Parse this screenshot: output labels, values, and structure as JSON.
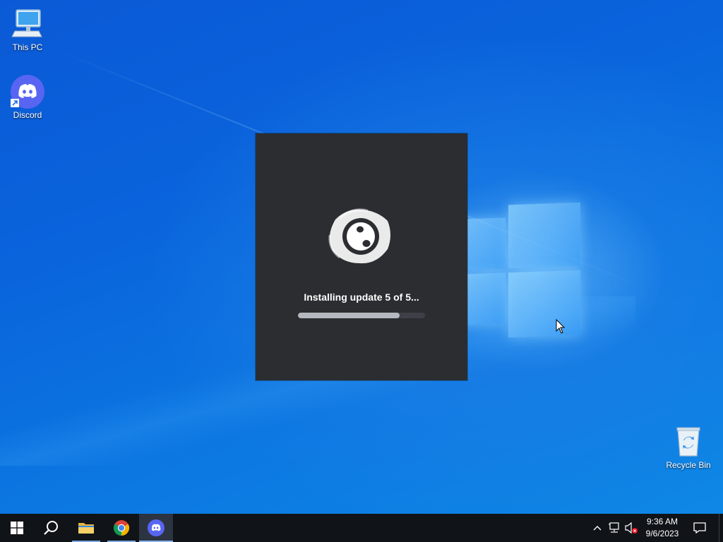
{
  "desktop": {
    "icons": [
      {
        "label": "This PC",
        "icon": "this-pc-icon"
      },
      {
        "label": "Discord",
        "icon": "discord-icon"
      },
      {
        "label": "Recycle Bin",
        "icon": "recycle-bin-icon"
      }
    ]
  },
  "splash": {
    "status": "Installing update 5 of 5...",
    "progress_fraction": 0.8,
    "logo_icon": "discord-updater-logo-icon",
    "background": "#2b2d31"
  },
  "taskbar": {
    "buttons": [
      {
        "name": "start",
        "icon": "windows-start-icon"
      },
      {
        "name": "search",
        "icon": "search-icon"
      },
      {
        "name": "file-explorer",
        "icon": "folder-icon"
      },
      {
        "name": "chrome",
        "icon": "chrome-icon"
      },
      {
        "name": "discord",
        "icon": "discord-icon",
        "active": true
      }
    ],
    "tray": {
      "icons": [
        "chevron-up-icon",
        "network-icon",
        "volume-muted-icon"
      ],
      "time": "9:36 AM",
      "date": "9/6/2023",
      "notification_icon": "notification-icon"
    }
  },
  "colors": {
    "discord_blurple": "#5865f2",
    "taskbar": "#101418"
  }
}
